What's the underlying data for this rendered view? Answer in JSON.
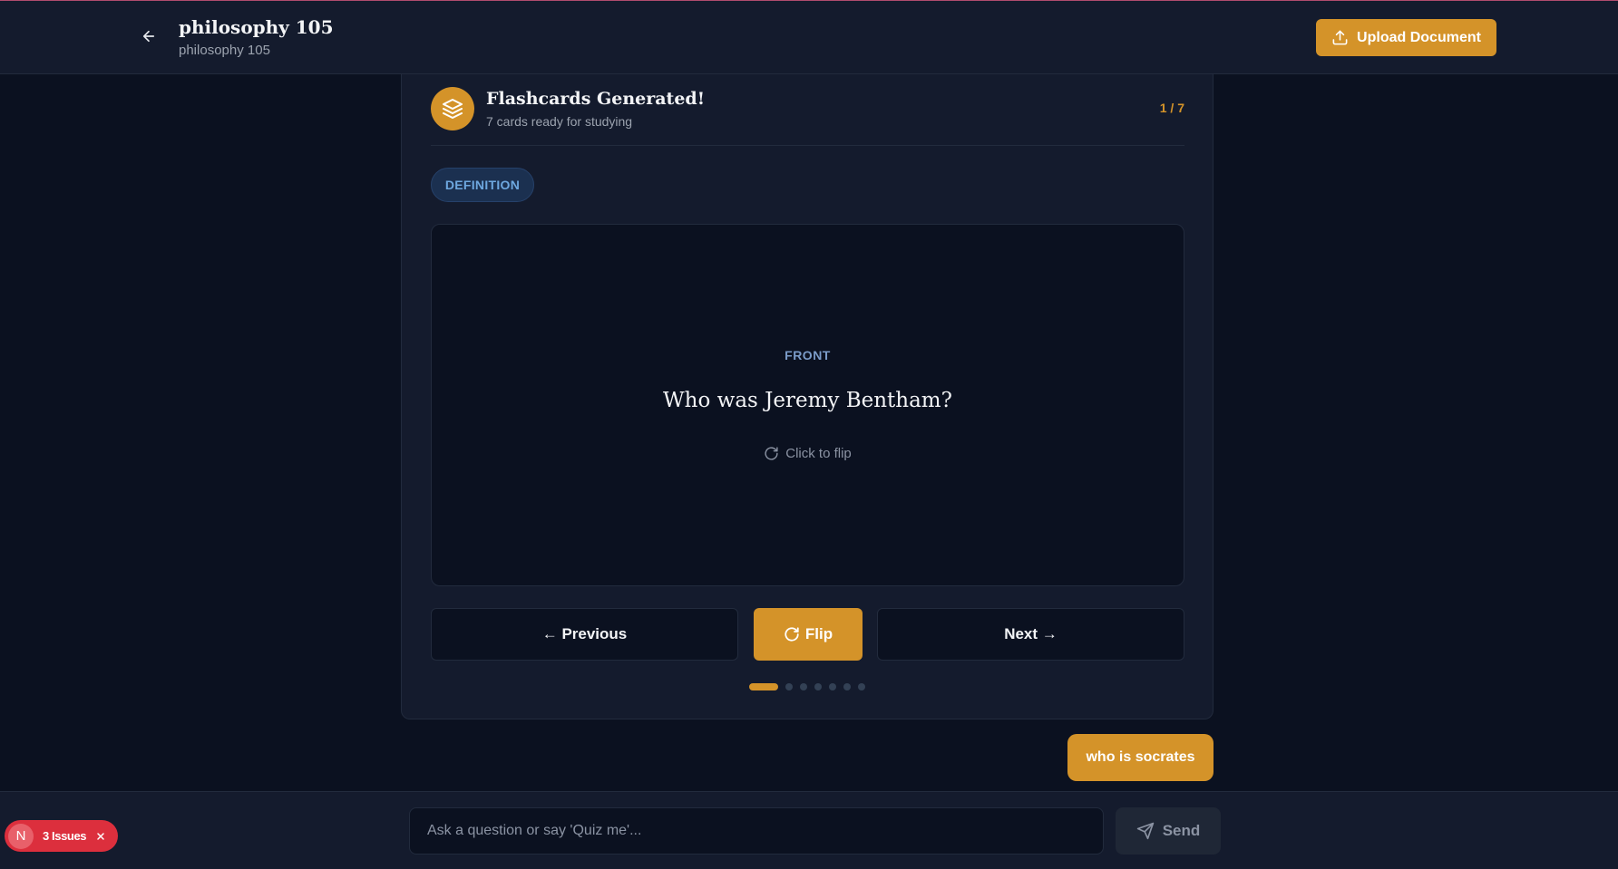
{
  "colors": {
    "accent": "#d49329",
    "background": "#0b1120",
    "surface": "#141b2d",
    "pill_text": "#6ea8e0",
    "issues_red": "#dc2f3d"
  },
  "header": {
    "back_icon": "arrow-left-icon",
    "title": "philosophy 105",
    "subtitle": "philosophy 105",
    "upload_icon": "upload-icon",
    "upload_label": "Upload Document"
  },
  "flashcards": {
    "header_icon": "layers-stack-icon",
    "title": "Flashcards Generated!",
    "subtitle": "7 cards ready for studying",
    "counter": "1 / 7",
    "current_index": 1,
    "total": 7,
    "card_type": "DEFINITION",
    "card": {
      "side": "FRONT",
      "question": "Who was Jeremy Bentham?",
      "hint_icon": "rotate-icon",
      "hint": "Click to flip"
    },
    "controls": {
      "previous_label": "← Previous",
      "flip_icon": "rotate-icon",
      "flip_label": "Flip",
      "next_label": "Next →"
    }
  },
  "chat": {
    "user_message": "who is socrates",
    "input_placeholder": "Ask a question or say 'Quiz me'...",
    "input_value": "",
    "send_icon": "send-icon",
    "send_label": "Send"
  },
  "issues_badge": {
    "letter": "N",
    "label": "3 Issues",
    "close_icon": "close-icon"
  }
}
